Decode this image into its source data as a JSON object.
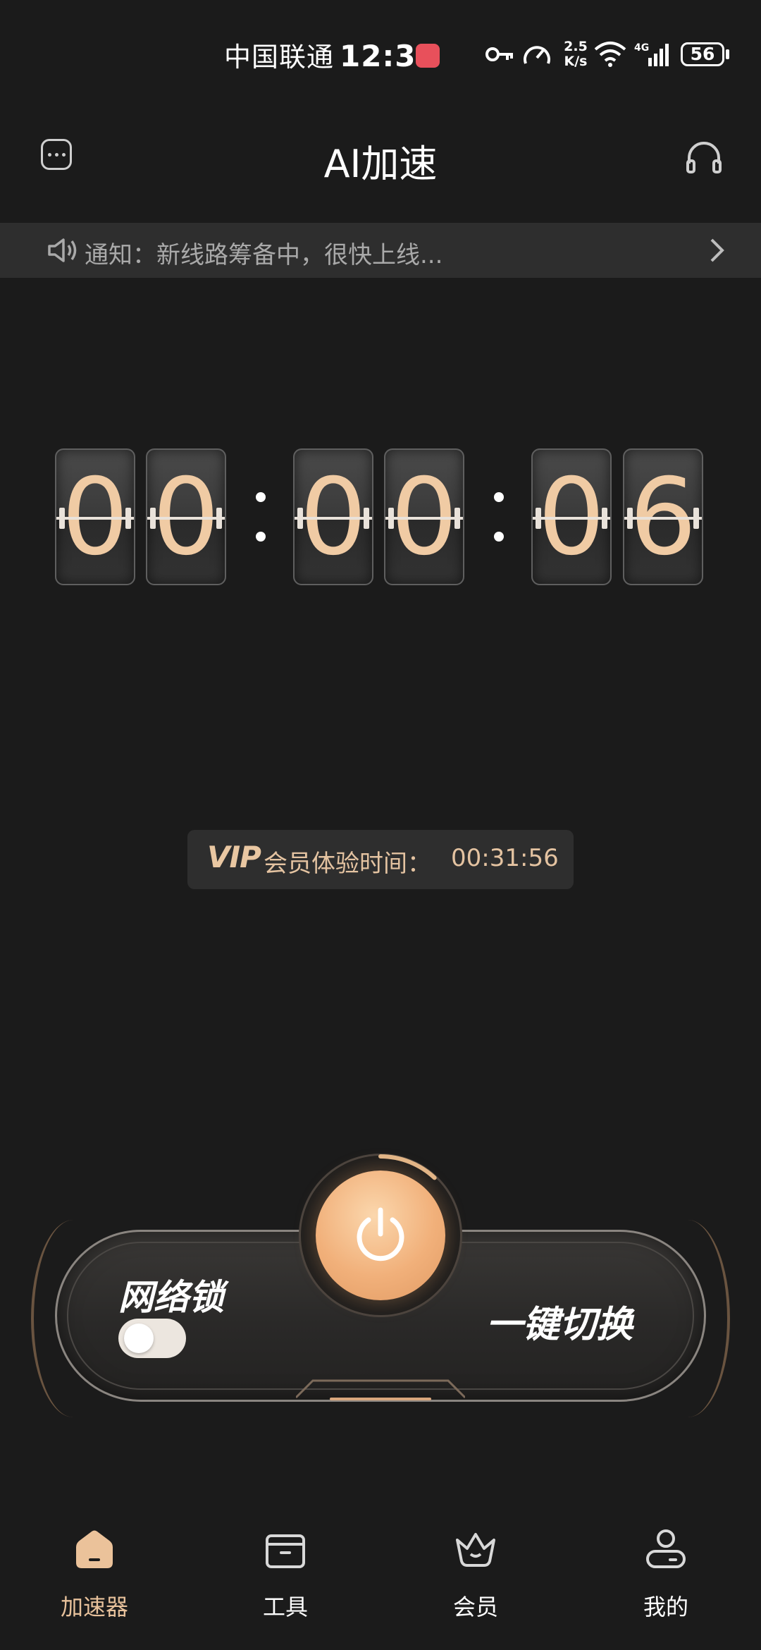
{
  "status_bar": {
    "carrier": "中国联通",
    "time": "12:35",
    "net_rate_top": "2.5",
    "net_rate_bottom": "K/s",
    "network": "4G",
    "battery": "56"
  },
  "header": {
    "title": "AI加速",
    "menu_icon": "more-dots-icon",
    "support_icon": "headset-icon"
  },
  "notice": {
    "text": "通知：新线路筹备中，很快上线..."
  },
  "timer": {
    "digits": [
      "0",
      "0",
      "0",
      "0",
      "0",
      "6"
    ]
  },
  "vip": {
    "logo": "VIP",
    "label": "会员体验时间：",
    "value": "00:31:56"
  },
  "control": {
    "lock_label": "网络锁",
    "lock_on": false,
    "switch_label": "一键切换",
    "power_progress": 0.12
  },
  "tabs": [
    {
      "label": "加速器",
      "icon": "house-icon",
      "active": true
    },
    {
      "label": "工具",
      "icon": "toolbox-icon",
      "active": false
    },
    {
      "label": "会员",
      "icon": "crown-icon",
      "active": false
    },
    {
      "label": "我的",
      "icon": "user-icon",
      "active": false
    }
  ],
  "colors": {
    "accent": "#e7c19b",
    "background": "#1b1b1b",
    "power": "#f1b07a"
  }
}
